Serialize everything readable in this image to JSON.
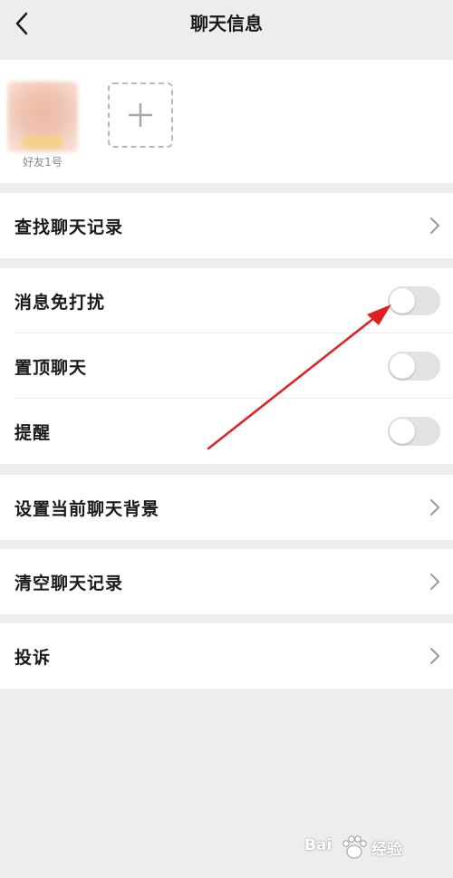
{
  "header": {
    "title": "聊天信息"
  },
  "members": [
    {
      "name": "好友1号"
    }
  ],
  "menu": {
    "search_history": "查找聊天记录",
    "mute": "消息免打扰",
    "pin": "置顶聊天",
    "remind": "提醒",
    "set_background": "设置当前聊天背景",
    "clear_history": "清空聊天记录",
    "report": "投诉"
  },
  "toggles": {
    "mute_on": false,
    "pin_on": false,
    "remind_on": false
  },
  "colors": {
    "background": "#ededed",
    "toggle_off": "#e2e2e2",
    "annotation_arrow": "#e02020"
  },
  "icons": {
    "back": "chevron-left-icon",
    "add": "plus-icon",
    "chevron": "chevron-right-icon"
  },
  "watermark": {
    "brand": "Bai",
    "suffix": "经验"
  }
}
